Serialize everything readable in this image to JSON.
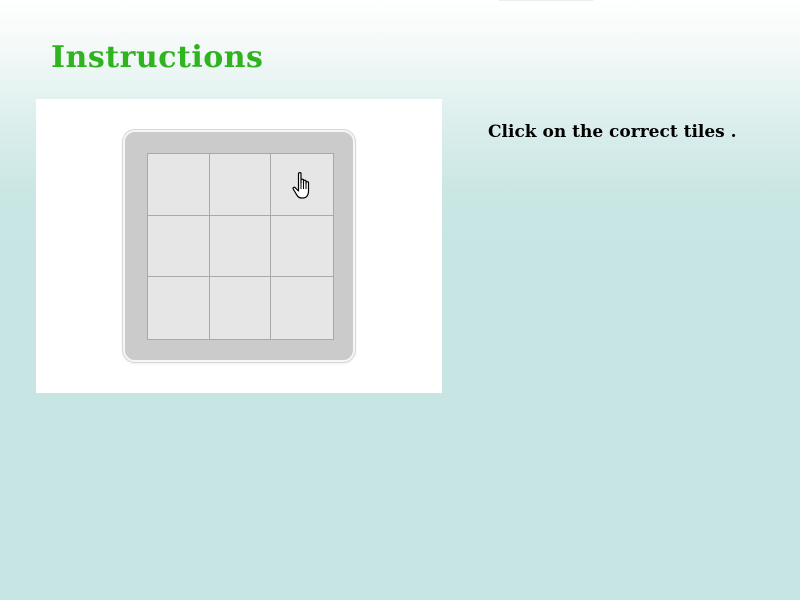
{
  "page": {
    "title": "Instructions",
    "instruction": "Click on the correct tiles ."
  },
  "demo": {
    "grid_rows": 3,
    "grid_cols": 3,
    "pointer_tile": 3,
    "pointer_icon": "hand-pointer-icon"
  },
  "colors": {
    "title": "#2fb31e",
    "background_top": "#ffffff",
    "background_bottom": "#c6e5e3",
    "board_frame": "#cbcbcb",
    "tile": "#e6e6e6",
    "tile_border": "#a9a9a9",
    "instruction_text": "#000000"
  }
}
